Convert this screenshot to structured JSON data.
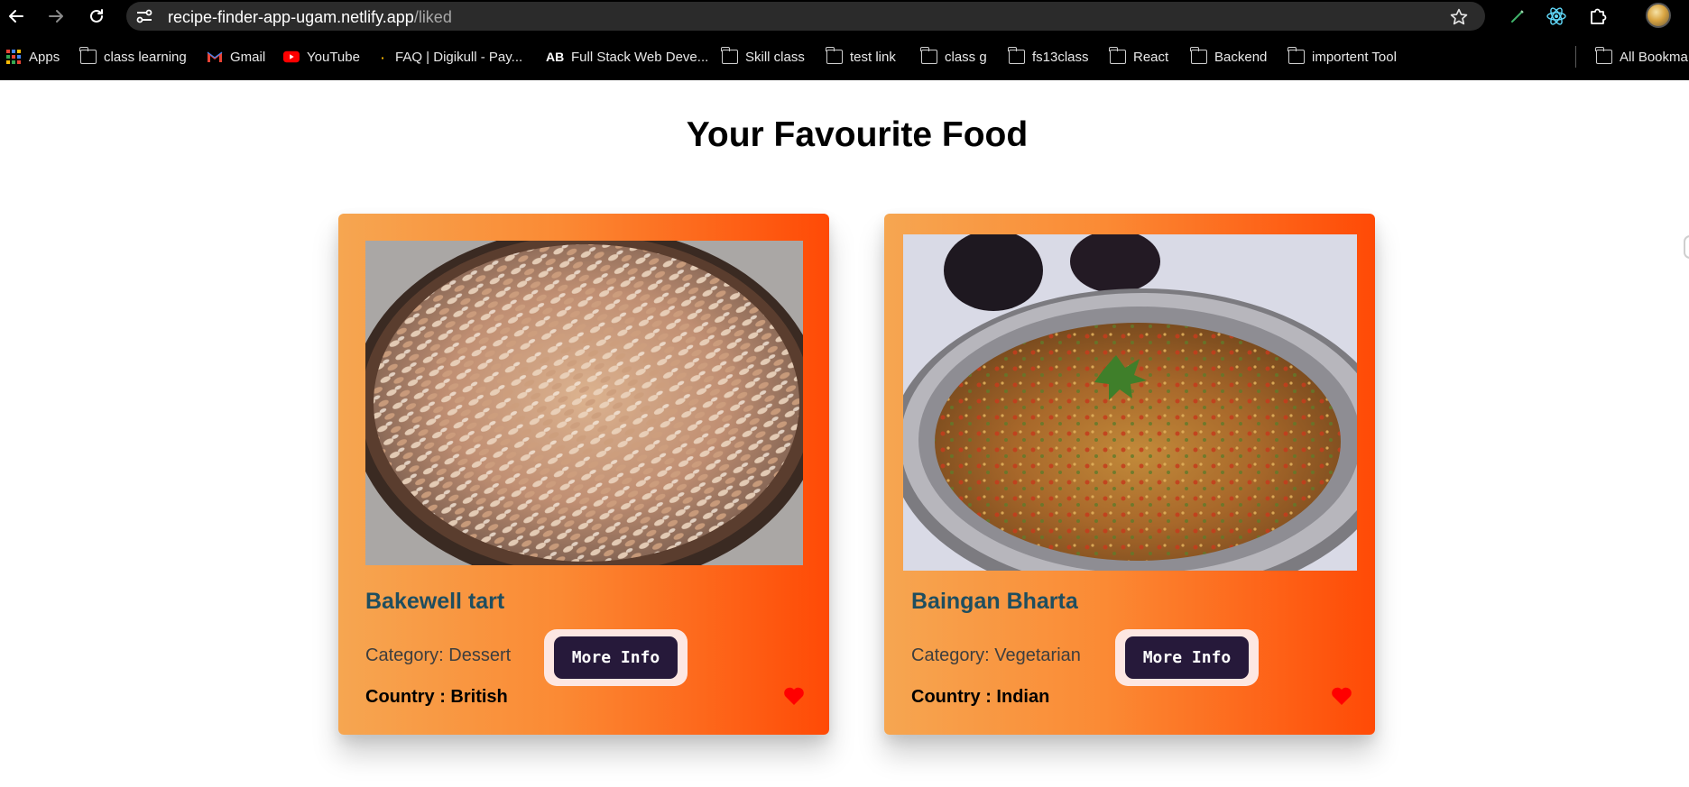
{
  "browser": {
    "url_host": "recipe-finder-app-ugam.netlify.app",
    "url_path": "/liked",
    "icons": [
      "back-arrow-icon",
      "forward-arrow-icon",
      "reload-icon",
      "site-info-icon",
      "star-icon",
      "pen-extension-icon",
      "react-devtools-icon",
      "puzzle-extensions-icon"
    ]
  },
  "bookmarks": [
    {
      "label": "Apps",
      "icon": "apps-grid-icon"
    },
    {
      "label": "class learning",
      "icon": "folder-icon"
    },
    {
      "label": "Gmail",
      "icon": "gmail-icon"
    },
    {
      "label": "YouTube",
      "icon": "youtube-icon"
    },
    {
      "label": "FAQ | Digikull - Pay...",
      "icon": "dot-icon"
    },
    {
      "label": "Full Stack Web Deve...",
      "icon": "ab-logo-icon"
    },
    {
      "label": "Skill class",
      "icon": "folder-icon"
    },
    {
      "label": "test link",
      "icon": "folder-icon"
    },
    {
      "label": "class g",
      "icon": "folder-icon"
    },
    {
      "label": "fs13class",
      "icon": "folder-icon"
    },
    {
      "label": "React",
      "icon": "folder-icon"
    },
    {
      "label": "Backend",
      "icon": "folder-icon"
    },
    {
      "label": "importent Tool",
      "icon": "folder-icon"
    },
    {
      "label": "All Bookma",
      "icon": "folder-icon"
    }
  ],
  "page": {
    "title": "Your Favourite Food"
  },
  "cards": [
    {
      "name": "Bakewell tart",
      "category": "Category: Dessert",
      "country": "Country : British",
      "button_label": "More Info",
      "liked": true
    },
    {
      "name": "Baingan Bharta",
      "category": "Category: Vegetarian",
      "country": "Country : Indian",
      "button_label": "More Info",
      "liked": true
    }
  ],
  "colors": {
    "card_gradient_start": "#f6a651",
    "card_gradient_end": "#ff4a06",
    "food_name": "#1f4e5f",
    "button_bg": "#26193a",
    "button_ring": "#fde7e2",
    "heart": "#ff0000"
  }
}
